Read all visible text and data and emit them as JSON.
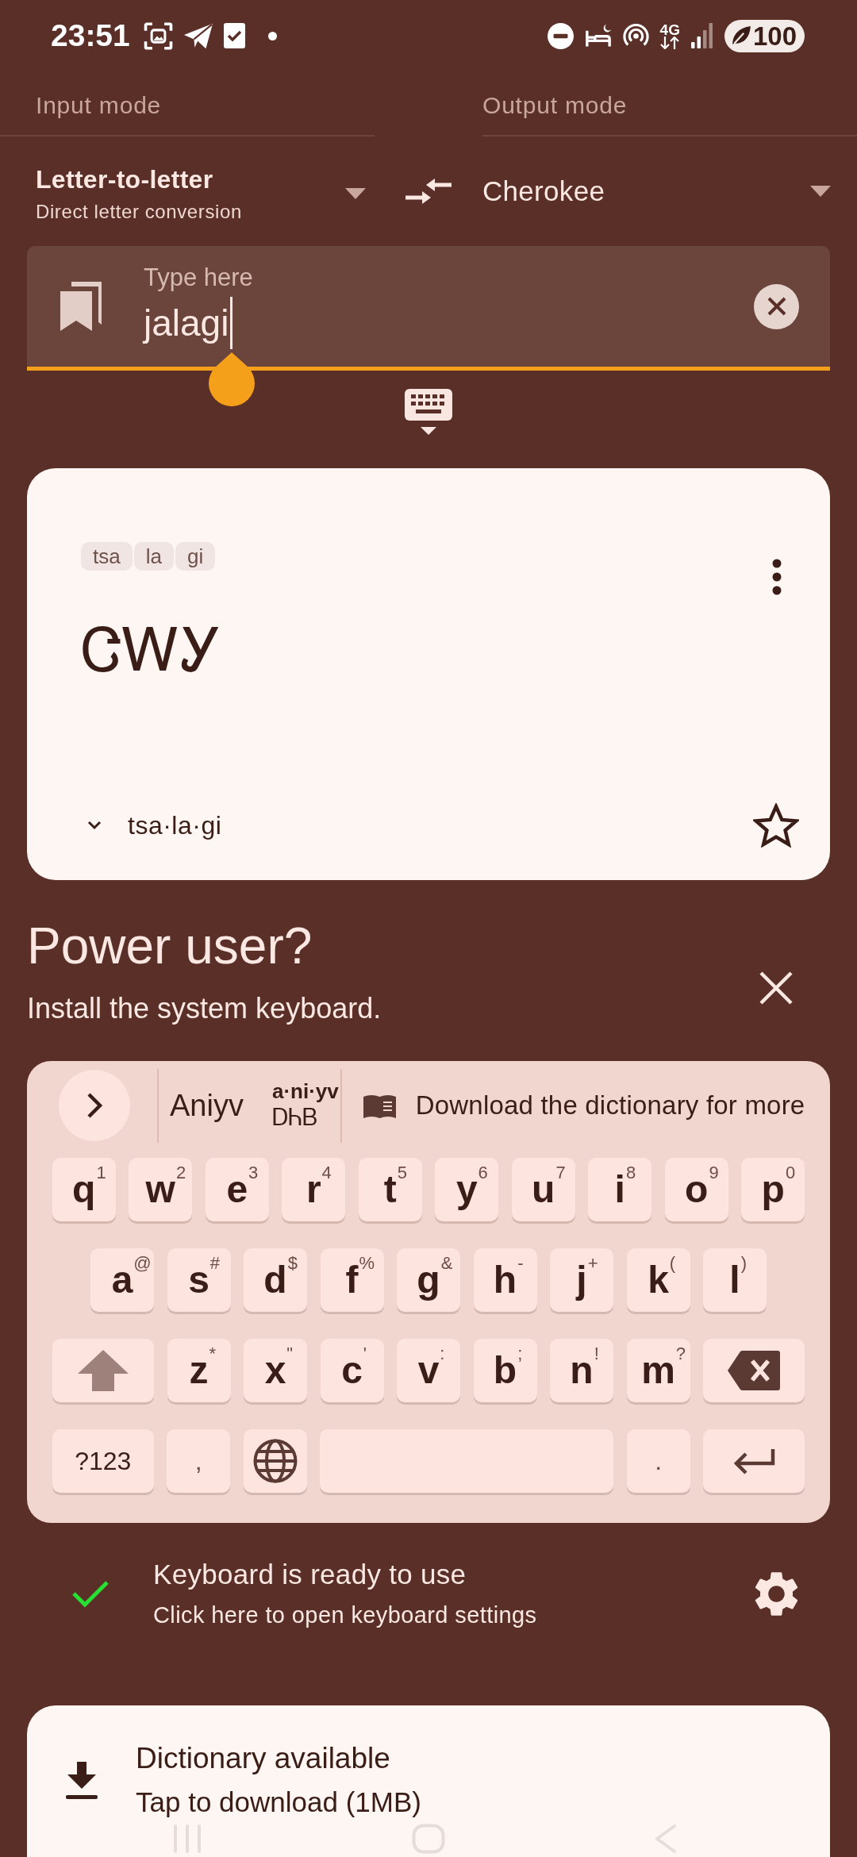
{
  "status_bar": {
    "time": "23:51",
    "network": "4G",
    "battery": "100"
  },
  "modes": {
    "input": {
      "label": "Input mode",
      "value": "Letter-to-letter",
      "description": "Direct letter conversion"
    },
    "output": {
      "label": "Output mode",
      "value": "Cherokee"
    }
  },
  "input_field": {
    "label": "Type here",
    "value": "jalagi"
  },
  "result_card": {
    "syllables": [
      "tsa",
      "la",
      "gi"
    ],
    "output": "ᏣᎳᎩ",
    "transliteration": "tsa·la·gi",
    "starred": false
  },
  "promo": {
    "title": "Power user?",
    "subtitle": "Install the system keyboard."
  },
  "keyboard": {
    "suggestions": [
      {
        "kind": "word",
        "text": "Aniyv"
      },
      {
        "kind": "stacked",
        "phonetic": "a·ni·yv",
        "syllabary": "ᎠᏂᏴ"
      },
      {
        "kind": "notice",
        "text": "Download the dictionary for more"
      }
    ],
    "rows": [
      {
        "keys": [
          {
            "kind": "char",
            "label": "q",
            "hint": "1"
          },
          {
            "kind": "char",
            "label": "w",
            "hint": "2"
          },
          {
            "kind": "char",
            "label": "e",
            "hint": "3"
          },
          {
            "kind": "char",
            "label": "r",
            "hint": "4"
          },
          {
            "kind": "char",
            "label": "t",
            "hint": "5"
          },
          {
            "kind": "char",
            "label": "y",
            "hint": "6"
          },
          {
            "kind": "char",
            "label": "u",
            "hint": "7"
          },
          {
            "kind": "char",
            "label": "i",
            "hint": "8"
          },
          {
            "kind": "char",
            "label": "o",
            "hint": "9"
          },
          {
            "kind": "char",
            "label": "p",
            "hint": "0"
          }
        ]
      },
      {
        "keys": [
          {
            "kind": "char",
            "label": "a",
            "hint": "@"
          },
          {
            "kind": "char",
            "label": "s",
            "hint": "#"
          },
          {
            "kind": "char",
            "label": "d",
            "hint": "$"
          },
          {
            "kind": "char",
            "label": "f",
            "hint": "%"
          },
          {
            "kind": "char",
            "label": "g",
            "hint": "&"
          },
          {
            "kind": "char",
            "label": "h",
            "hint": "-"
          },
          {
            "kind": "char",
            "label": "j",
            "hint": "+"
          },
          {
            "kind": "char",
            "label": "k",
            "hint": "("
          },
          {
            "kind": "char",
            "label": "l",
            "hint": ")"
          }
        ]
      },
      {
        "keys": [
          {
            "kind": "shift",
            "on": false
          },
          {
            "kind": "char",
            "label": "z",
            "hint": "*"
          },
          {
            "kind": "char",
            "label": "x",
            "hint": "\""
          },
          {
            "kind": "char",
            "label": "c",
            "hint": "'"
          },
          {
            "kind": "char",
            "label": "v",
            "hint": ":"
          },
          {
            "kind": "char",
            "label": "b",
            "hint": ";"
          },
          {
            "kind": "char",
            "label": "n",
            "hint": "!"
          },
          {
            "kind": "char",
            "label": "m",
            "hint": "?"
          },
          {
            "kind": "backspace"
          }
        ]
      },
      {
        "keys": [
          {
            "kind": "mode",
            "label": "?123"
          },
          {
            "kind": "symbol",
            "label": ","
          },
          {
            "kind": "globe"
          },
          {
            "kind": "space"
          },
          {
            "kind": "symbol",
            "label": "."
          },
          {
            "kind": "enter"
          }
        ]
      }
    ]
  },
  "keyboard_status": {
    "ready": true,
    "title": "Keyboard is ready to use",
    "subtitle": "Click here to open keyboard settings"
  },
  "dictionary": {
    "title": "Dictionary available",
    "subtitle": "Tap to download (1MB)"
  }
}
